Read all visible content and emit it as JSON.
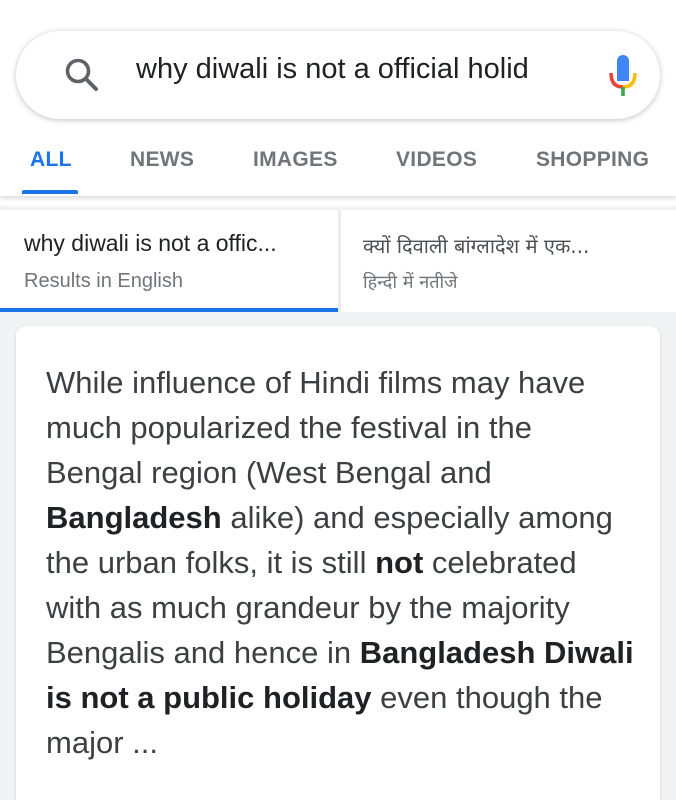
{
  "search": {
    "query": "why diwali is not a official holid",
    "icon": "search-icon",
    "mic_icon": "mic-icon"
  },
  "tabs": [
    {
      "label": "ALL",
      "active": true
    },
    {
      "label": "NEWS",
      "active": false
    },
    {
      "label": "IMAGES",
      "active": false
    },
    {
      "label": "VIDEOS",
      "active": false
    },
    {
      "label": "SHOPPING",
      "active": false
    }
  ],
  "language_options": [
    {
      "title": "why diwali is not a offic...",
      "subtitle": "Results in English",
      "selected": true
    },
    {
      "title": "क्यों दिवाली बांग्लादेश में एक...",
      "subtitle": "हिन्दी में नतीजे",
      "selected": false
    }
  ],
  "snippet": {
    "segments": [
      {
        "text": "While influence of Hindi films may have much popularized the festival in the Bengal region (West Bengal and ",
        "bold": false
      },
      {
        "text": "Bangladesh",
        "bold": true
      },
      {
        "text": " alike) and especially among the urban folks, it is still ",
        "bold": false
      },
      {
        "text": "not",
        "bold": true
      },
      {
        "text": " celebrated with as much grandeur by the majority Bengalis and hence in ",
        "bold": false
      },
      {
        "text": "Bangladesh Diwali is not a public holiday",
        "bold": true
      },
      {
        "text": " even though the major ...",
        "bold": false
      }
    ]
  },
  "colors": {
    "accent": "#1a73e8",
    "tab_inactive": "#70757a",
    "mic_blue": "#4285f4",
    "mic_red": "#ea4335",
    "mic_yellow": "#fbbc04",
    "mic_green": "#34a853"
  }
}
